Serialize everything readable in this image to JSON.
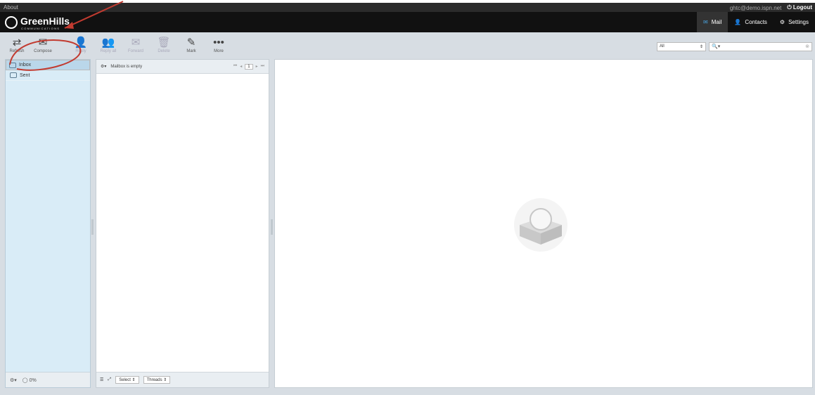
{
  "topbar": {
    "about": "About",
    "email": "ghtc@demo.ispn.net",
    "logout": "Logout"
  },
  "brand": {
    "name": "GreenHills",
    "subtitle": "COMMUNICATIONS"
  },
  "nav": {
    "mail": "Mail",
    "contacts": "Contacts",
    "settings": "Settings"
  },
  "toolbar": {
    "refresh": "Refresh",
    "compose": "Compose",
    "reply": "Reply",
    "reply_all": "Reply all",
    "forward": "Forward",
    "delete": "Delete",
    "mark": "Mark",
    "more": "More"
  },
  "filter": {
    "selected": "All"
  },
  "folders": [
    {
      "label": "Inbox"
    },
    {
      "label": "Sent"
    }
  ],
  "quota": "0%",
  "messagelist": {
    "status": "Mailbox is empty",
    "page": "1",
    "select_label": "Select",
    "threads_label": "Threads"
  },
  "colors": {
    "header": "#111111",
    "toolbar": "#d7dde3",
    "folders_bg": "#d9ecf7",
    "accent": "#4aa3df",
    "annotation": "#c23b30"
  }
}
